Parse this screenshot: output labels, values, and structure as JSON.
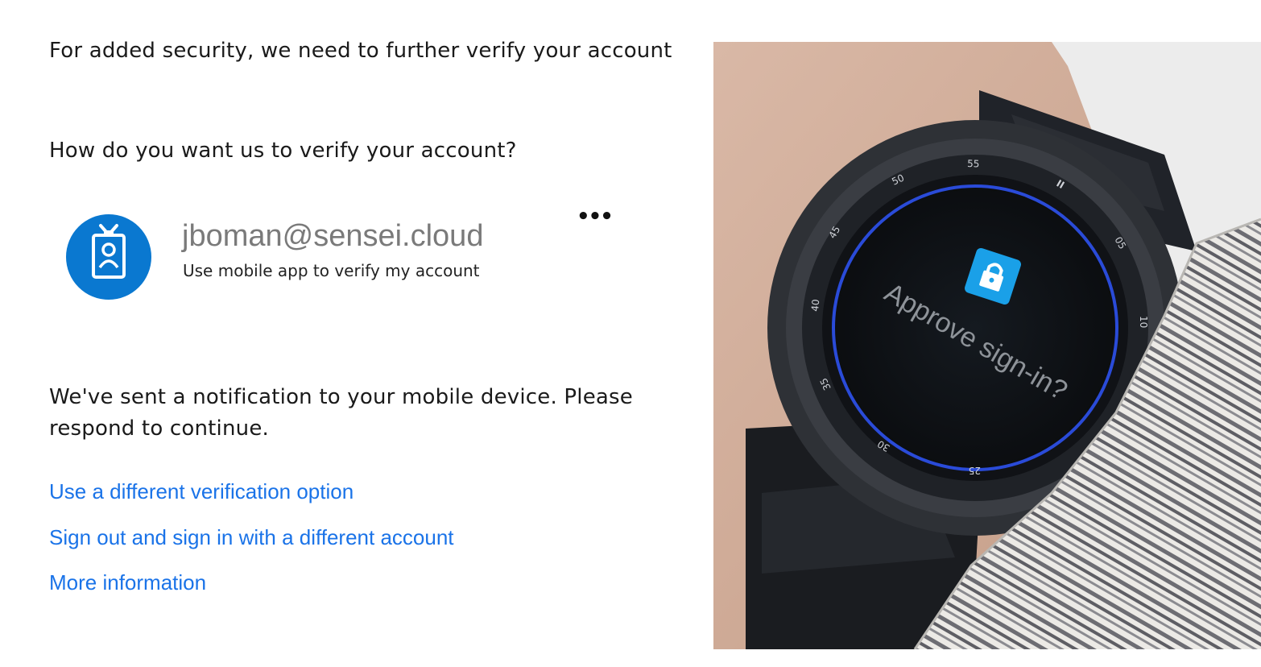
{
  "heading": "For added security, we need to further verify your account",
  "question": "How do you want us to verify your account?",
  "account": {
    "email": "jboman@sensei.cloud",
    "method": "Use mobile app to verify my account",
    "more_options": "•••",
    "avatar_icon": "id-badge-icon"
  },
  "notice": "We've sent a notification to your mobile device. Please respond to continue.",
  "links": {
    "different_option": "Use a different verification option",
    "sign_out": "Sign out and sign in with a different account",
    "more_info": "More information"
  },
  "watch": {
    "prompt": "Approve sign-in?",
    "bezel_numbers": [
      "55",
      "50",
      "45",
      "40",
      "35",
      "30",
      "25",
      "05",
      "10"
    ]
  },
  "colors": {
    "link": "#1a73e8",
    "avatar": "#0a78d0",
    "watch_ring": "#2a4bd8"
  }
}
